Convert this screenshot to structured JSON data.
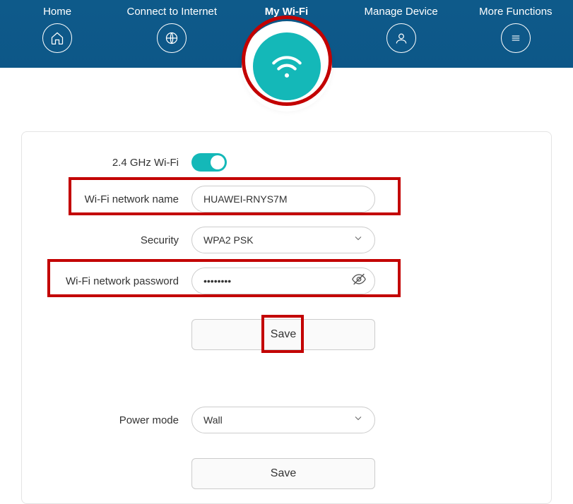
{
  "nav": {
    "home": "Home",
    "connect": "Connect to Internet",
    "wifi": "My Wi-Fi",
    "manage": "Manage Device",
    "more": "More Functions"
  },
  "form": {
    "ghz24_label": "2.4 GHz Wi-Fi",
    "name_label": "Wi-Fi network name",
    "name_value": "HUAWEI-RNYS7M",
    "security_label": "Security",
    "security_value": "WPA2 PSK",
    "password_label": "Wi-Fi network password",
    "password_value": "••••••••",
    "save1": "Save",
    "power_label": "Power mode",
    "power_value": "Wall",
    "save2": "Save"
  }
}
